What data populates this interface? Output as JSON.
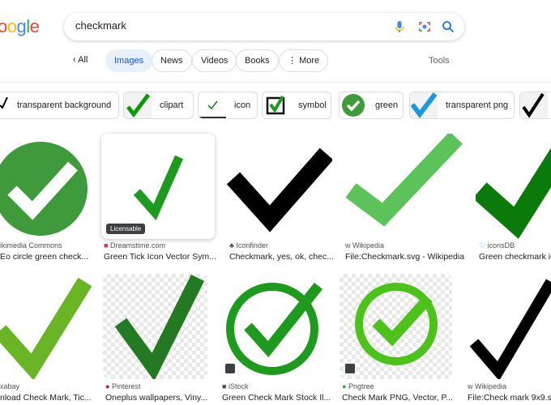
{
  "logo": "oogle",
  "search": {
    "query": "checkmark"
  },
  "tabs": {
    "back": "All",
    "items": [
      "Images",
      "News",
      "Videos",
      "Books",
      "More"
    ],
    "tools": "Tools"
  },
  "chips": [
    "transparent background",
    "clipart",
    "icon",
    "symbol",
    "green",
    "transparent png"
  ],
  "row1": [
    {
      "source": "ikimedia Commons",
      "title": "Eo circle green check..."
    },
    {
      "source": "Dreamstime.com",
      "title": "Green Tick Icon Vector Sym...",
      "badge": "Licensable"
    },
    {
      "source": "Iconfinder",
      "title": "Checkmark, yes, ok, chec..."
    },
    {
      "source": "Wikipedia",
      "title": "File:Checkmark.svg - Wikipedia"
    },
    {
      "source": "iconsDB",
      "title": "Green checkmark ic"
    }
  ],
  "row2": [
    {
      "source": "xabay",
      "title": "nload Check Mark, Tic..."
    },
    {
      "source": "Pinterest",
      "title": "Oneplus wallpapers, Viny..."
    },
    {
      "source": "iStock",
      "title": "Green Check Mark Stock Il..."
    },
    {
      "source": "Pngtree",
      "title": "Check Mark PNG, Vector, P..."
    },
    {
      "source": "Wikipedia",
      "title": "File:Check mark 9x9.sv"
    }
  ],
  "colors": {
    "accent": "#1a55c8",
    "active_tab_bg": "#e8f0fe",
    "green": "#3e9a3a"
  }
}
